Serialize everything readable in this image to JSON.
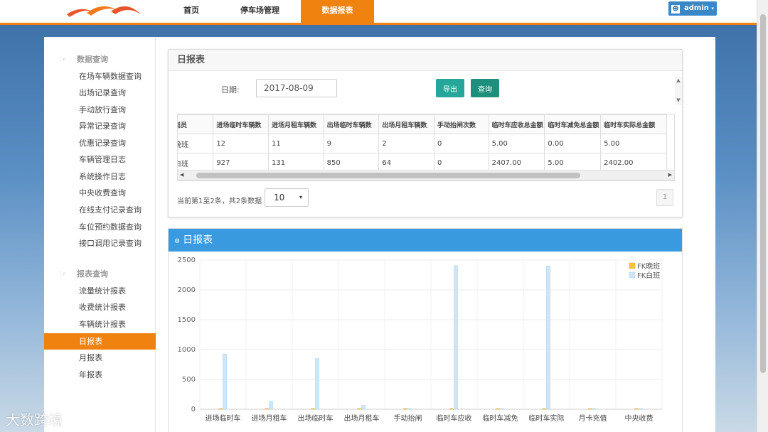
{
  "nav": {
    "items": [
      "首页",
      "停车场管理",
      "数据报表"
    ],
    "active": 2
  },
  "admin": {
    "label": "admin"
  },
  "sidebar": {
    "groups": [
      {
        "title": "数据查询",
        "items": [
          "在场车辆数据查询",
          "出场记录查询",
          "手动放行查询",
          "异常记录查询",
          "优惠记录查询",
          "车辆管理日志",
          "系统操作日志",
          "中央收费查询",
          "在线支付记录查询",
          "车位预约数据查询",
          "接口调用记录查询"
        ]
      },
      {
        "title": "报表查询",
        "items": [
          "流量统计报表",
          "收费统计报表",
          "车辆统计报表",
          "日报表",
          "月报表",
          "年报表"
        ]
      }
    ],
    "active": "日报表"
  },
  "report": {
    "title": "日报表",
    "date_label": "日期:",
    "date_value": "2017-08-09",
    "export_label": "导出",
    "query_label": "查询",
    "table": {
      "headers": [
        "岗员",
        "进场临时车辆数",
        "进场月租车辆数",
        "出场临时车辆数",
        "出场月租车辆数",
        "手动抬闸次数",
        "临时车应收总金额",
        "临时车减免总金额",
        "临时车实际总金额"
      ],
      "rows": [
        [
          "晚班",
          "12",
          "11",
          "9",
          "2",
          "0",
          "5.00",
          "0.00",
          "5.00"
        ],
        [
          "白班",
          "927",
          "131",
          "850",
          "64",
          "0",
          "2407.00",
          "5.00",
          "2402.00"
        ]
      ]
    },
    "page_info": "当前第1至2条，共2条数据",
    "page_size": "10",
    "page_number": "1"
  },
  "chart_panel": {
    "title": "日报表"
  },
  "chart_data": {
    "type": "bar",
    "categories": [
      "进场临时车",
      "进场月租车",
      "出场临时车",
      "出场月租车",
      "手动抬闸",
      "临时车应收",
      "临时车减免",
      "临时车实际",
      "月卡充值",
      "中央收费"
    ],
    "series": [
      {
        "name": "FK晚班",
        "values": [
          12,
          11,
          9,
          2,
          0,
          5,
          0,
          5,
          0,
          0
        ],
        "color": "#f5c242"
      },
      {
        "name": "FK白班",
        "values": [
          927,
          131,
          850,
          64,
          0,
          2407,
          5,
          2402,
          0,
          0
        ],
        "color": "#cfe6f7"
      }
    ],
    "yticks": [
      0,
      500,
      1000,
      1500,
      2000,
      2500
    ],
    "ylim": [
      0,
      2500
    ],
    "legend": "top-right",
    "grid": true
  },
  "watermark": "大数跨境"
}
